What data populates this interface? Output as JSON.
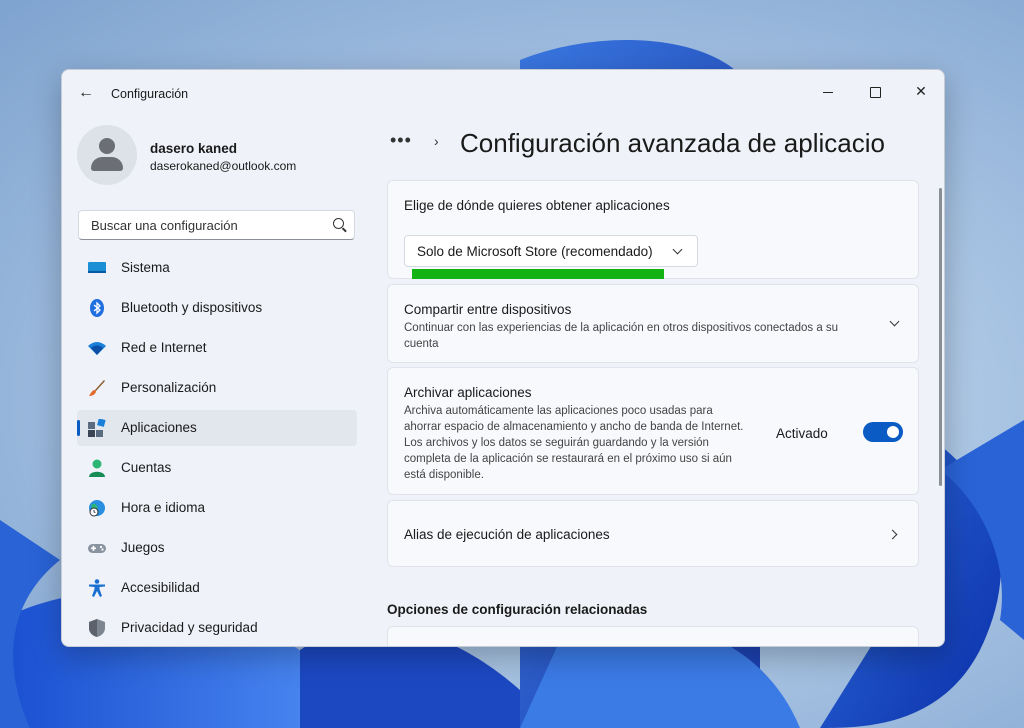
{
  "window": {
    "app_title": "Configuración"
  },
  "user": {
    "name": "dasero kaned",
    "email": "daserokaned@outlook.com"
  },
  "search": {
    "placeholder": "Buscar una configuración"
  },
  "sidebar": {
    "items": [
      {
        "label": "Sistema",
        "icon": "monitor-icon"
      },
      {
        "label": "Bluetooth y dispositivos",
        "icon": "bluetooth-icon"
      },
      {
        "label": "Red e Internet",
        "icon": "wifi-icon"
      },
      {
        "label": "Personalización",
        "icon": "brush-icon"
      },
      {
        "label": "Aplicaciones",
        "icon": "apps-icon",
        "active": true
      },
      {
        "label": "Cuentas",
        "icon": "person-icon"
      },
      {
        "label": "Hora e idioma",
        "icon": "globe-clock-icon"
      },
      {
        "label": "Juegos",
        "icon": "gamepad-icon"
      },
      {
        "label": "Accesibilidad",
        "icon": "accessibility-icon"
      },
      {
        "label": "Privacidad y seguridad",
        "icon": "shield-icon"
      }
    ]
  },
  "breadcrumb": {
    "dots": "•••",
    "separator": "›"
  },
  "page": {
    "title": "Configuración avanzada de aplicacio"
  },
  "cards": {
    "source": {
      "title": "Elige de dónde quieres obtener aplicaciones",
      "dropdown_value": "Solo de Microsoft Store (recomendado)"
    },
    "share": {
      "title": "Compartir entre dispositivos",
      "description": "Continuar con las experiencias de la aplicación en otros dispositivos conectados a su cuenta"
    },
    "archive": {
      "title": "Archivar aplicaciones",
      "description": "Archiva automáticamente las aplicaciones poco usadas para ahorrar espacio de almacenamiento y ancho de banda de Internet. Los archivos y los datos se seguirán guardando y la versión completa de la aplicación se restaurará en el próximo uso si aún está disponible.",
      "toggle_label": "Activado",
      "toggle_on": true
    },
    "alias": {
      "title": "Alias de ejecución de aplicaciones"
    }
  },
  "related": {
    "title": "Opciones de configuración relacionadas"
  },
  "colors": {
    "accent": "#0a5bc4",
    "highlight": "#12b312"
  }
}
